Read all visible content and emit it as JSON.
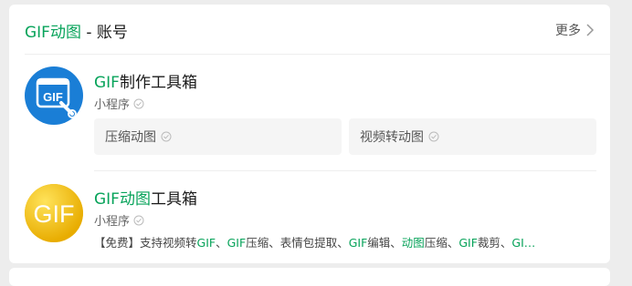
{
  "header": {
    "title_highlight": "GIF动图",
    "title_rest": " - 账号",
    "more_label": "更多"
  },
  "accounts": [
    {
      "name_highlight": "GIF",
      "name_rest": "制作工具箱",
      "type": "小程序",
      "avatar_text": "GIF",
      "services": [
        "压缩动图",
        "视频转动图"
      ]
    },
    {
      "name_highlight": "GIF动图",
      "name_rest": "工具箱",
      "type": "小程序",
      "avatar_text": "GIF",
      "desc_parts": [
        {
          "t": "【免费】支持视频转",
          "g": false
        },
        {
          "t": "GIF",
          "g": true
        },
        {
          "t": "、",
          "g": false
        },
        {
          "t": "GIF",
          "g": true
        },
        {
          "t": "压缩、表情包提取、",
          "g": false
        },
        {
          "t": "GIF",
          "g": true
        },
        {
          "t": "编辑、",
          "g": false
        },
        {
          "t": "动图",
          "g": true
        },
        {
          "t": "压缩、",
          "g": false
        },
        {
          "t": "GIF",
          "g": true
        },
        {
          "t": "裁剪、",
          "g": false
        },
        {
          "t": "GI…",
          "g": true
        }
      ]
    }
  ],
  "colors": {
    "accent": "#07a35a",
    "avatar1": "#1a7ed6",
    "avatar2": "#f2c31a"
  },
  "icons": {
    "more": "chevron-right-icon",
    "verified": "verified-check-icon"
  }
}
